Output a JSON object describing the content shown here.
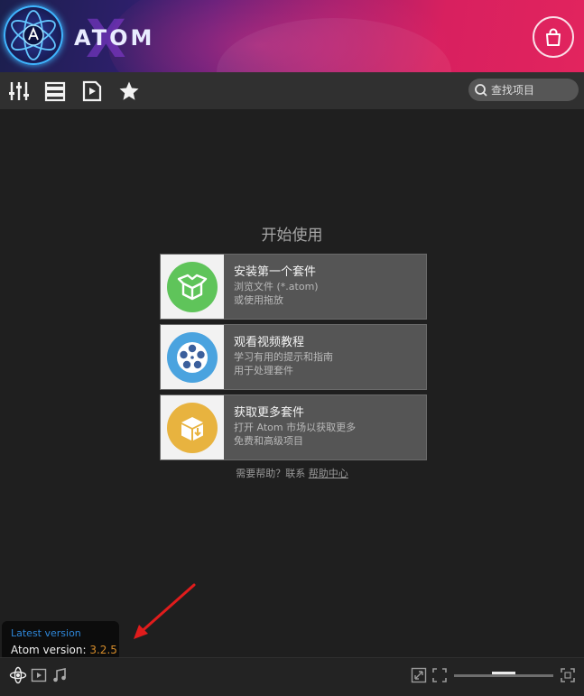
{
  "header": {
    "logo_text": "ATOM",
    "logo_x": "X",
    "colors": {
      "accent_blue": "#2e86d8",
      "version_orange": "#d48b2a",
      "install_green": "#5fc45a",
      "video_blue": "#4aa3df",
      "market_yellow": "#e8b33f"
    }
  },
  "toolbar": {
    "icons": [
      "sliders-icon",
      "list-icon",
      "play-file-icon",
      "star-icon"
    ],
    "search_placeholder": "查找项目"
  },
  "main": {
    "title": "开始使用",
    "cards": [
      {
        "title": "安装第一个套件",
        "line1": "浏览文件 (*.atom)",
        "line2": "或使用拖放",
        "icon": "package-open-icon"
      },
      {
        "title": "观看视频教程",
        "line1": "学习有用的提示和指南",
        "line2": "用于处理套件",
        "icon": "film-reel-icon"
      },
      {
        "title": "获取更多套件",
        "line1": "打开 Atom 市场以获取更多",
        "line2": "免费和高级项目",
        "icon": "download-box-icon"
      }
    ],
    "help_text": "需要帮助？联系",
    "help_link": "帮助中心"
  },
  "tooltip": {
    "title": "Latest version",
    "label": "Atom version: ",
    "version": "3.2.5"
  },
  "bottombar": {
    "left_icons": [
      "atom-icon",
      "video-icon",
      "music-icon"
    ],
    "right_icons": [
      "shrink-icon",
      "fit-icon",
      "fullscreen-icon"
    ],
    "zoom_fraction": 0.5
  }
}
